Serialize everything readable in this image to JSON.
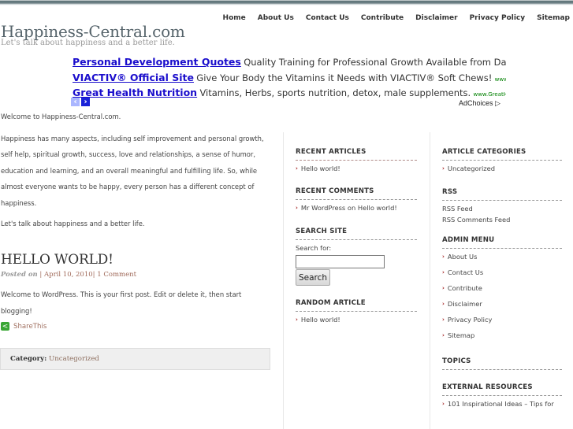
{
  "nav": [
    "Home",
    "About Us",
    "Contact Us",
    "Contribute",
    "Disclaimer",
    "Privacy Policy",
    "Sitemap"
  ],
  "site": {
    "title": "Happiness-Central.com",
    "tagline": "Let's talk about happiness and a better life."
  },
  "ads": [
    {
      "title": "Personal Development Quotes",
      "desc": "Quality Training for Professional Growth Available from Dale Carnegie...",
      "url": ""
    },
    {
      "title": "VIACTIV® Official Site",
      "desc": "Give Your Body the Vitamins it Needs with VIACTIV® Soft Chews!",
      "url": "www.Viactiv.com"
    },
    {
      "title": "Great Health Nutrition",
      "desc": "Vitamins, Herbs, sports nutrition, detox, male supplements.",
      "url": "www.GreatHealthNutritio..."
    }
  ],
  "ad_controls": {
    "prev": "‹",
    "next": "›",
    "adchoices": "AdChoices ▷"
  },
  "main": {
    "welcome": "Welcome to Happiness-Central.com.",
    "intro": "Happiness has many aspects, including self improvement and personal growth, self help, spiritual growth, success, love and relationships, a sense of humor, education and learning, and an overall meaningful and fulfilling life. So, while almost everyone wants to be happy, every person has a different concept of happiness.",
    "closing": "Let's talk about happiness and a better life."
  },
  "post": {
    "title": "HELLO WORLD!",
    "posted_on_label": "Posted on",
    "date": "April 10, 2010",
    "comments": "1 Comment",
    "sep": "|",
    "body": "Welcome to WordPress. This is your first post. Edit or delete it, then start blogging!",
    "share": "ShareThis",
    "category_label": "Category:",
    "category": "Uncategorized"
  },
  "sidebar_left": {
    "recent_articles": {
      "title": "RECENT ARTICLES",
      "items": [
        "Hello world!"
      ]
    },
    "recent_comments": {
      "title": "RECENT COMMENTS",
      "items": [
        "Mr WordPress on Hello world!"
      ]
    },
    "search": {
      "title": "SEARCH SITE",
      "label": "Search for:",
      "value": "",
      "button": "Search"
    },
    "random_article": {
      "title": "RANDOM ARTICLE",
      "items": [
        "Hello world!"
      ]
    }
  },
  "sidebar_right": {
    "categories": {
      "title": "ARTICLE CATEGORIES",
      "items": [
        "Uncategorized"
      ]
    },
    "rss": {
      "title": "RSS",
      "items": [
        "RSS Feed",
        "RSS Comments Feed"
      ]
    },
    "admin_menu": {
      "title": "ADMIN MENU",
      "items": [
        "About Us",
        "Contact Us",
        "Contribute",
        "Disclaimer",
        "Privacy Policy",
        "Sitemap"
      ]
    },
    "topics": {
      "title": "TOPICS"
    },
    "external": {
      "title": "EXTERNAL RESOURCES",
      "items": [
        "101 Inspirational Ideas – Tips for"
      ]
    }
  }
}
